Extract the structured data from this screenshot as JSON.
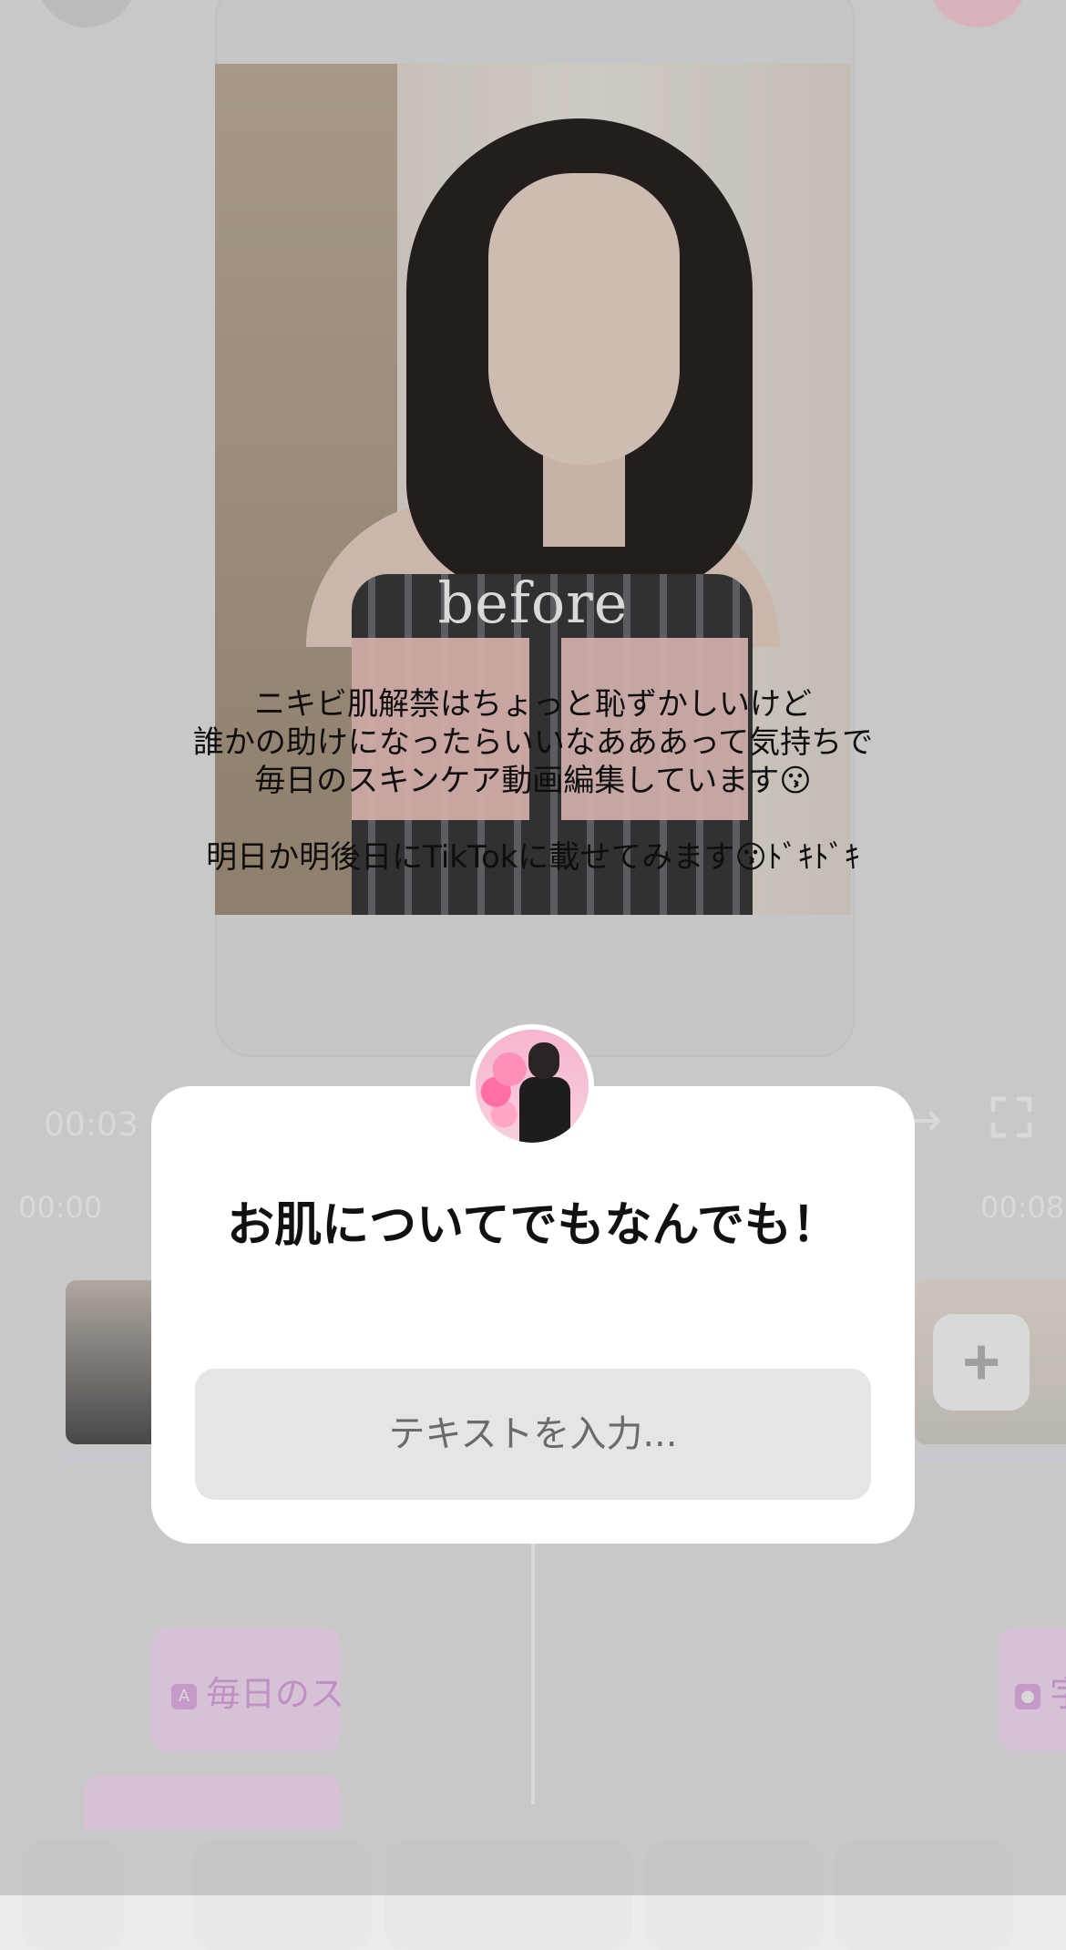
{
  "preview": {
    "photo_label": "before",
    "caption_lines": [
      "ニキビ肌解禁はちょっと恥ずかしいけど",
      "誰かの助けになったらいいなあああって気持ちで",
      "毎日のスキンケア動画編集しています😗",
      "明日か明後日にTikTokに載せてみます😗ﾄﾞｷﾄﾞｷ"
    ]
  },
  "timeline": {
    "current_time": "00:03",
    "tick_start": "00:00",
    "tick_end": "00:08",
    "text_chips": [
      {
        "label": "毎日のスキンケア"
      },
      {
        "label": "字"
      }
    ]
  },
  "dialog": {
    "title": "お肌についてでもなんでも！",
    "input_placeholder": "テキストを入力...",
    "input_value": ""
  },
  "icons": {
    "add": "plus-icon",
    "redo": "redo-icon",
    "fullscreen": "fullscreen-icon"
  },
  "colors": {
    "dialog_bg": "#ffffff",
    "input_bg": "#e5e5e5",
    "chip_bg": "#fbe5fb",
    "chip_text": "#e2a9e6",
    "record_button": "#ffd0da"
  }
}
